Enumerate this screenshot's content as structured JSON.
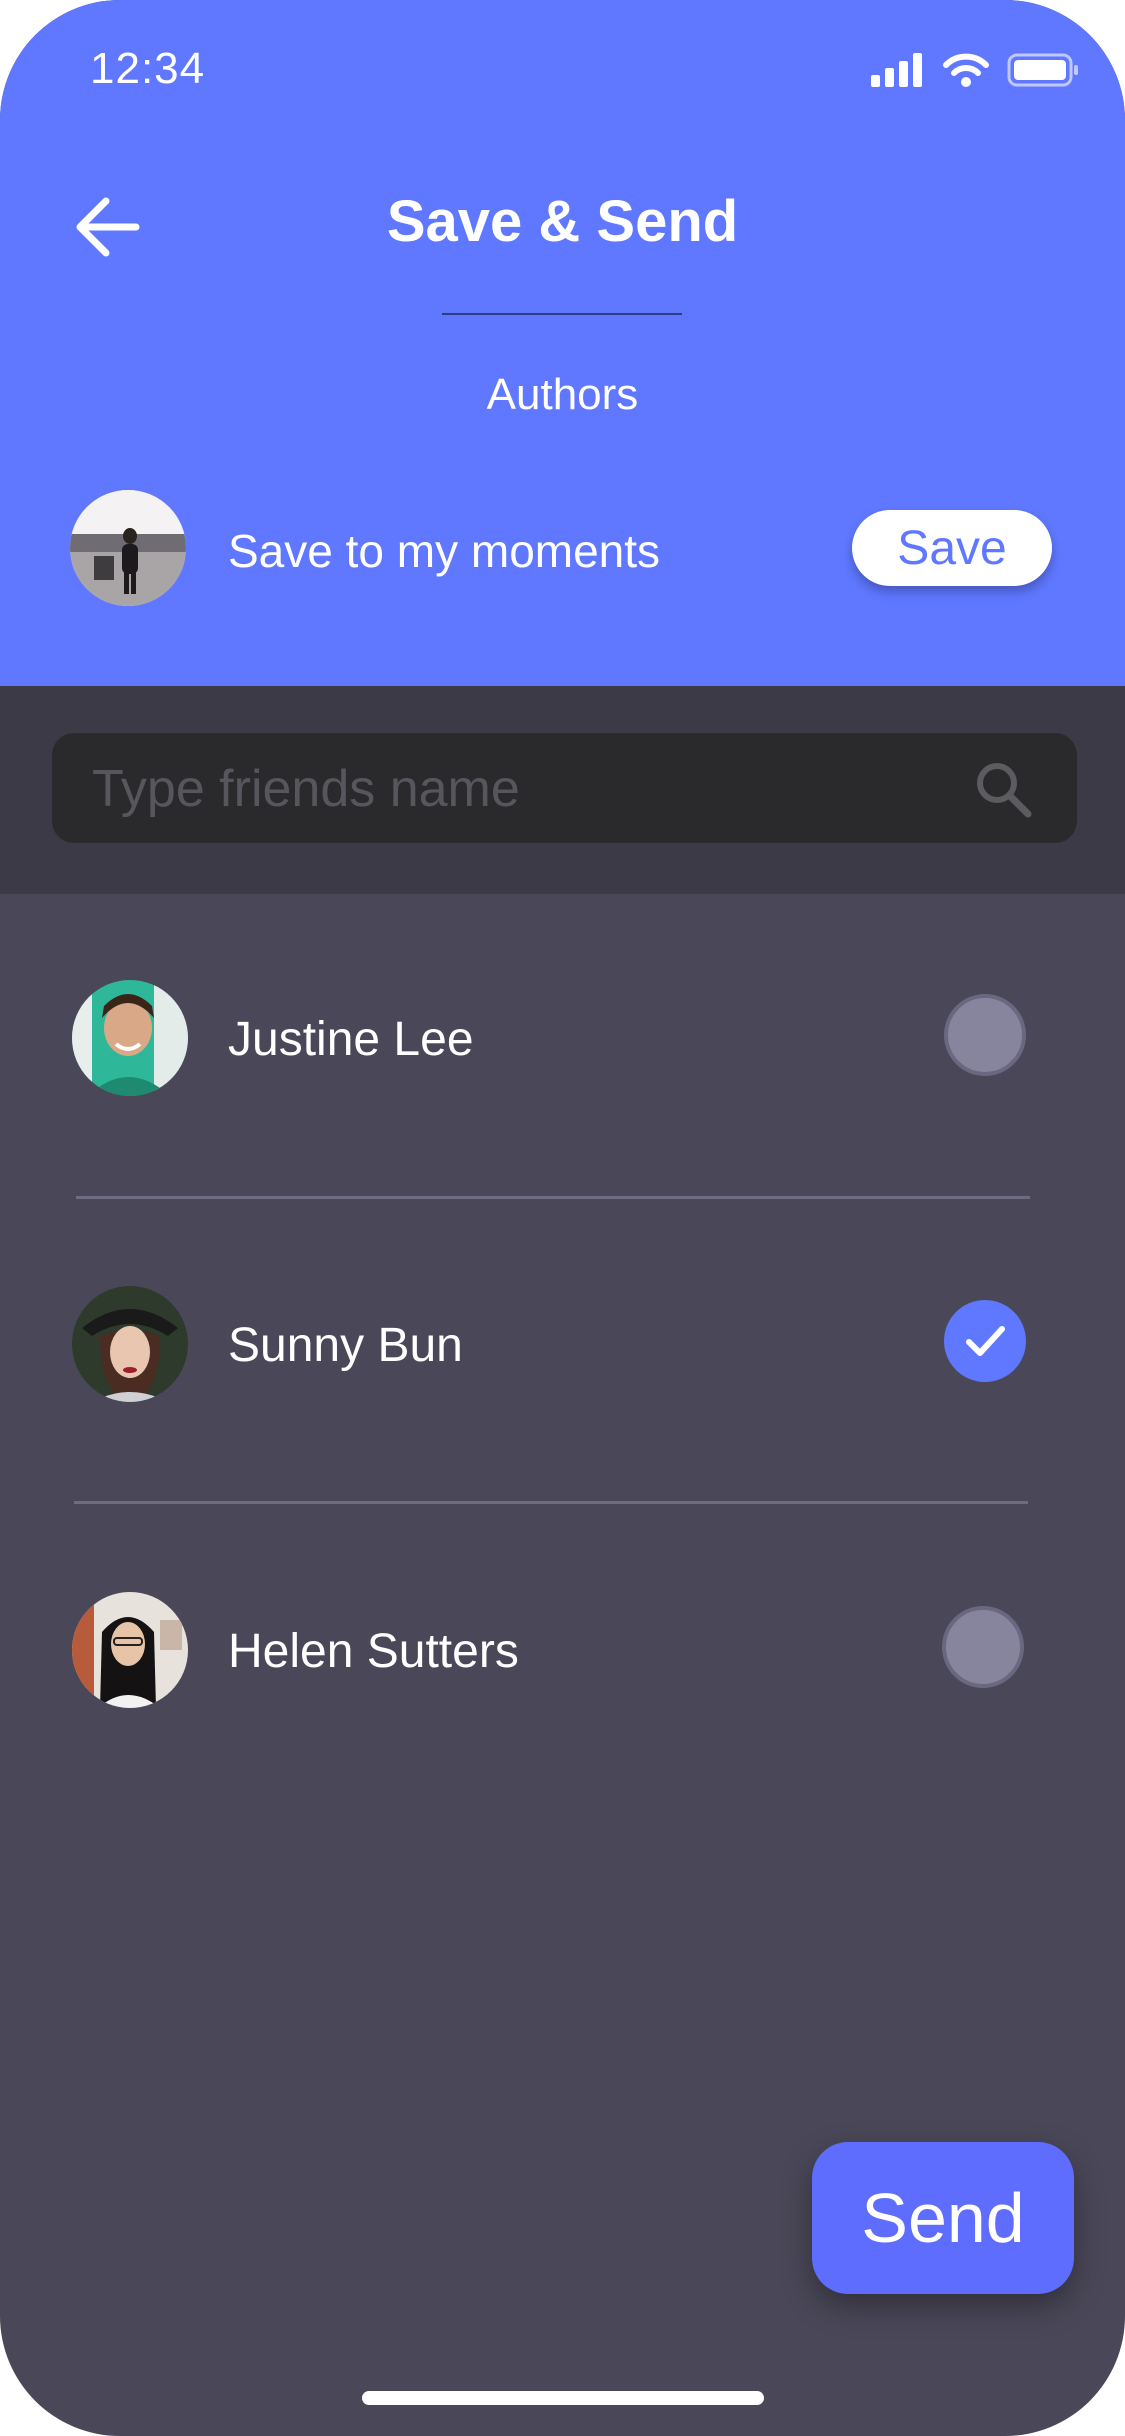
{
  "status_bar": {
    "time": "12:34"
  },
  "header": {
    "title": "Save & Send",
    "subtitle": "Authors",
    "save_row": {
      "label": "Save to my moments",
      "button_label": "Save"
    }
  },
  "search": {
    "placeholder": "Type friends name",
    "icon": "search-icon"
  },
  "friends": [
    {
      "name": "Justine Lee",
      "selected": false
    },
    {
      "name": "Sunny Bun",
      "selected": true
    },
    {
      "name": "Helen Sutters",
      "selected": false
    }
  ],
  "actions": {
    "send_label": "Send"
  },
  "colors": {
    "accent": "#5f78ff",
    "background": "#4a4858",
    "search_band": "#3c3a47",
    "search_box": "#2a2a2d"
  }
}
